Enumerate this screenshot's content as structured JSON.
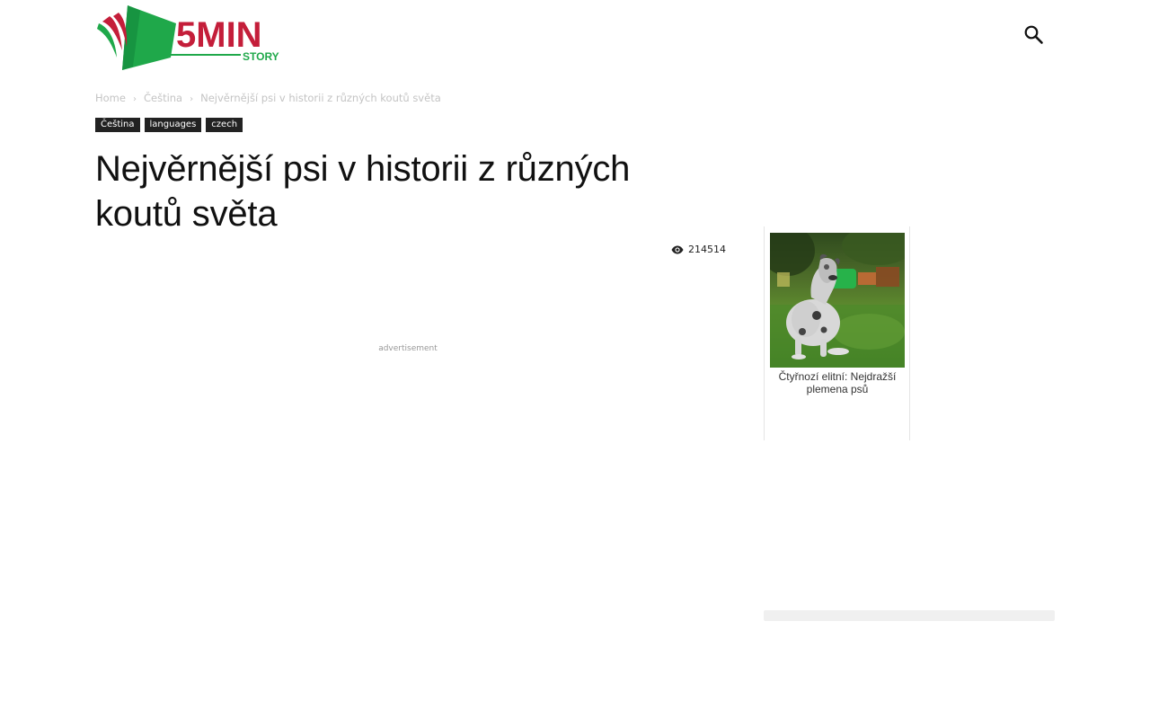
{
  "header": {
    "logo_text": "5MIN",
    "logo_subtext": "STORY",
    "brand_colors": {
      "red": "#c41e3a",
      "green": "#1fa84a",
      "dark_green": "#0e7a3a"
    },
    "search_icon": "search-icon"
  },
  "breadcrumb": {
    "items": [
      "Home",
      "Čeština",
      "Nejvěrnější psi v historii z různých koutů světa"
    ],
    "separator": "›"
  },
  "tags": [
    "Čeština",
    "languages",
    "czech"
  ],
  "article": {
    "title": "Nejvěrnější psi v historii z různých koutů světa",
    "views": "214514",
    "views_icon": "eye-icon",
    "ad_label": "advertisement"
  },
  "sidebar": {
    "card": {
      "caption": "Čtyřnozí elitní: Nejdražší plemena psů",
      "image": "great-dane-dog-on-grass"
    }
  }
}
